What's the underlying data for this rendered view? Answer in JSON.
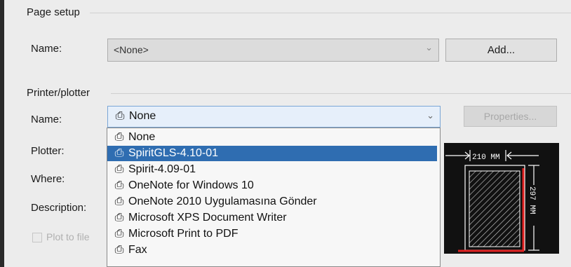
{
  "page_setup": {
    "title": "Page setup",
    "name_label": "Name:",
    "name_value": "<None>",
    "add_button": "Add..."
  },
  "printer": {
    "title": "Printer/plotter",
    "name_label": "Name:",
    "selected": "None",
    "properties_button": "Properties...",
    "plotter_label": "Plotter:",
    "where_label": "Where:",
    "description_label": "Description:",
    "plot_to_file_label": "Plot to file",
    "dropdown_items": [
      {
        "label": "None",
        "selected": false
      },
      {
        "label": "SpiritGLS-4.10-01",
        "selected": true
      },
      {
        "label": "Spirit-4.09-01",
        "selected": false
      },
      {
        "label": "OneNote for Windows 10",
        "selected": false
      },
      {
        "label": "OneNote 2010 Uygulamasına Gönder",
        "selected": false
      },
      {
        "label": "Microsoft XPS Document Writer",
        "selected": false
      },
      {
        "label": "Microsoft Print to PDF",
        "selected": false
      },
      {
        "label": "Fax",
        "selected": false
      }
    ]
  },
  "preview": {
    "width_label": "210 MM",
    "height_label": "297 MM"
  },
  "icons": {
    "printer": "printer-icon",
    "dropdown": "chevron-down-icon"
  },
  "colors": {
    "selection": "#2f6db1",
    "preview_bg": "#111111",
    "margin_red": "#e02020"
  }
}
